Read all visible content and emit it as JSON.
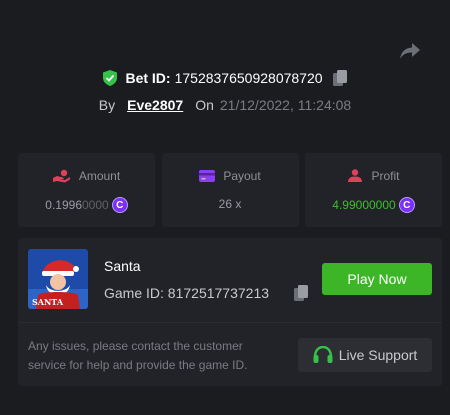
{
  "bet": {
    "label": "Bet ID:",
    "id": "1752837650928078720",
    "by_label": "By",
    "user": "Eve2807",
    "on_label": "On",
    "date": "21/12/2022, 11:24:08"
  },
  "stats": {
    "amount": {
      "label": "Amount",
      "value_main": "0.1996",
      "value_dim": "0000"
    },
    "payout": {
      "label": "Payout",
      "value": "26 x"
    },
    "profit": {
      "label": "Profit",
      "value_main": "4.99",
      "value_dim": "000000"
    }
  },
  "coin_symbol": "C",
  "game": {
    "name": "Santa",
    "id_label": "Game ID:",
    "id": "8172517737213",
    "play_label": "Play Now",
    "thumb_text": "SANTA"
  },
  "support": {
    "message": "Any issues, please contact the customer service for help and provide the game ID.",
    "button_label": "Live Support"
  },
  "colors": {
    "background": "#1b1c20",
    "card": "#222328",
    "green": "#3cb626",
    "coin": "#7b2ff7"
  }
}
